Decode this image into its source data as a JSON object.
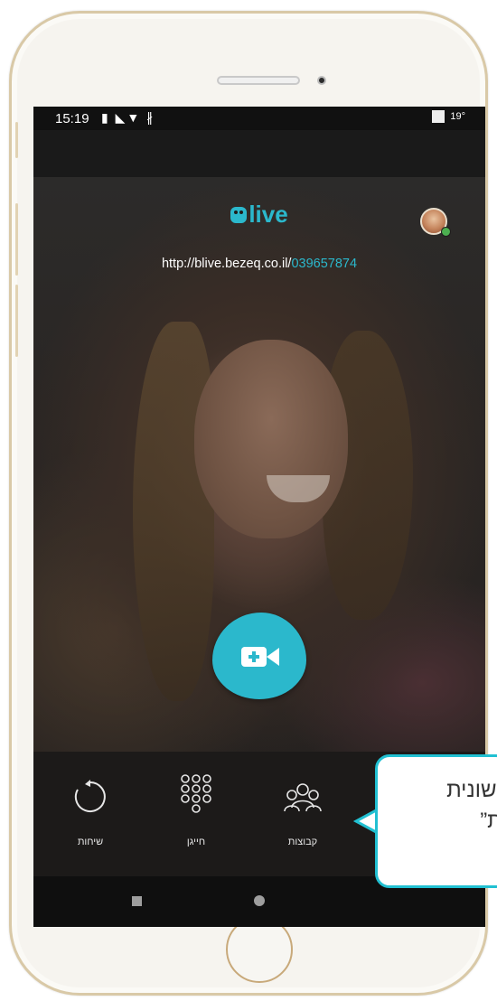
{
  "status_bar": {
    "time": "15:19",
    "icons": "▮ ◣▼ ∦",
    "temperature": "19°"
  },
  "app": {
    "brand_name": "live",
    "link_prefix": "http://blive.bezeq.co.il/",
    "link_id": "039657874"
  },
  "tabs": [
    {
      "label": "שיחות",
      "icon": "call-history-icon"
    },
    {
      "label": "חייגן",
      "icon": "dialpad-icon"
    },
    {
      "label": "קבוצות",
      "icon": "groups-icon"
    }
  ],
  "callout": {
    "line1": "לשונית",
    "line2": "ות”"
  },
  "colors": {
    "accent": "#2bb8cc",
    "callout_border": "#21c0d2"
  }
}
